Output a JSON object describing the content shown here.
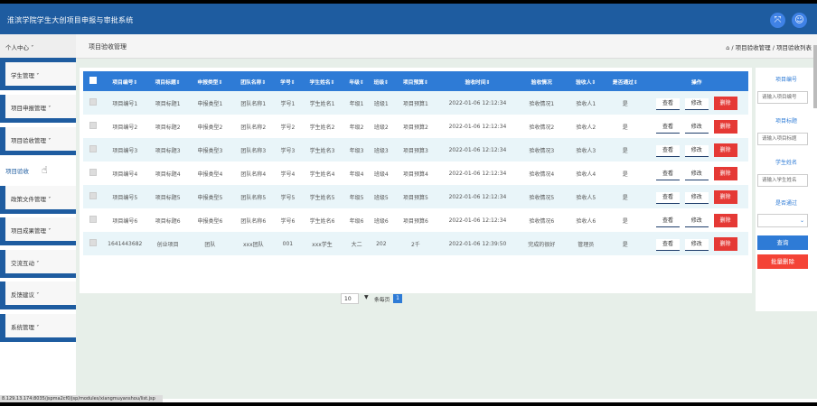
{
  "header": {
    "title": "淮滨学院学生大创项目申报与审批系统",
    "expand_icon": "expand-icon",
    "user_icon": "user-icon"
  },
  "sidebar": {
    "items": [
      {
        "label": "个人中心 ˅",
        "name": "sidebar-item-personal-center"
      },
      {
        "label": "学生管理 ˅",
        "name": "sidebar-item-student-management"
      },
      {
        "label": "项目申报管理 ˅",
        "name": "sidebar-item-project-declaration"
      },
      {
        "label": "项目验收管理 ˅",
        "name": "sidebar-item-project-acceptance"
      },
      {
        "label": "项目验收",
        "name": "sidebar-item-project-check"
      },
      {
        "label": "政策文件管理 ˅",
        "name": "sidebar-item-policy-files"
      },
      {
        "label": "项目成果管理 ˅",
        "name": "sidebar-item-project-results"
      },
      {
        "label": "交流互动 ˅",
        "name": "sidebar-item-communication"
      },
      {
        "label": "反馈建议 ˅",
        "name": "sidebar-item-feedback"
      },
      {
        "label": "系统管理 ˅",
        "name": "sidebar-item-system"
      }
    ]
  },
  "breadcrumb": {
    "page_title": "项目验收管理",
    "path": "⌂ / 项目验收管理 / 项目验收列表"
  },
  "table": {
    "headers": [
      "项目编号⇕",
      "项目标题⇕",
      "申报类型⇕",
      "团队名称⇕",
      "学号⇕",
      "学生姓名⇕",
      "年级⇕",
      "班级⇕",
      "项目预算⇕",
      "验收时间⇕",
      "验收情况",
      "验收人⇕",
      "是否通过⇕",
      "操作"
    ],
    "rows": [
      [
        "项目编号1",
        "项目标题1",
        "申报类型1",
        "团队名称1",
        "学号1",
        "学生姓名1",
        "年级1",
        "班级1",
        "项目预算1",
        "2022-01-06 12:12:34",
        "验收情况1",
        "验收人1",
        "是"
      ],
      [
        "项目编号2",
        "项目标题2",
        "申报类型2",
        "团队名称2",
        "学号2",
        "学生姓名2",
        "年级2",
        "班级2",
        "项目预算2",
        "2022-01-06 12:12:34",
        "验收情况2",
        "验收人2",
        "是"
      ],
      [
        "项目编号3",
        "项目标题3",
        "申报类型3",
        "团队名称3",
        "学号3",
        "学生姓名3",
        "年级3",
        "班级3",
        "项目预算3",
        "2022-01-06 12:12:34",
        "验收情况3",
        "验收人3",
        "是"
      ],
      [
        "项目编号4",
        "项目标题4",
        "申报类型4",
        "团队名称4",
        "学号4",
        "学生姓名4",
        "年级4",
        "班级4",
        "项目预算4",
        "2022-01-06 12:12:34",
        "验收情况4",
        "验收人4",
        "是"
      ],
      [
        "项目编号5",
        "项目标题5",
        "申报类型5",
        "团队名称5",
        "学号5",
        "学生姓名5",
        "年级5",
        "班级5",
        "项目预算5",
        "2022-01-06 12:12:34",
        "验收情况5",
        "验收人5",
        "是"
      ],
      [
        "项目编号6",
        "项目标题6",
        "申报类型6",
        "团队名称6",
        "学号6",
        "学生姓名6",
        "年级6",
        "班级6",
        "项目预算6",
        "2022-01-06 12:12:34",
        "验收情况6",
        "验收人6",
        "是"
      ],
      [
        "1641443682",
        "创业项目",
        "团队",
        "xxx团队",
        "001",
        "xxx学生",
        "大二",
        "202",
        "2千",
        "2022-01-06 12:39:50",
        "完成的很好",
        "管理员",
        "是"
      ]
    ],
    "actions": {
      "view": "查看",
      "edit": "修改",
      "delete": "删除"
    }
  },
  "pagination": {
    "page_size": "10",
    "label": "条每页",
    "current_page": "1"
  },
  "search_panel": {
    "project_no_label": "项目编号",
    "project_no_placeholder": "请输入项目编号",
    "project_title_label": "项目标题",
    "project_title_placeholder": "请输入项目标题",
    "student_name_label": "学生姓名",
    "student_name_placeholder": "请输入学生姓名",
    "passed_label": "是否通过",
    "query_button": "查询",
    "batch_delete_button": "批量删除"
  },
  "status_bar": {
    "url": "8.129.13.174:8035/jspma2cf0/jsp/modules/xiangmuyanshou/list.jsp"
  },
  "colors": {
    "header_bg": "#1e5ca0",
    "table_header": "#2e7bd6",
    "delete": "#e53935",
    "main_bg": "#e7efe9"
  }
}
